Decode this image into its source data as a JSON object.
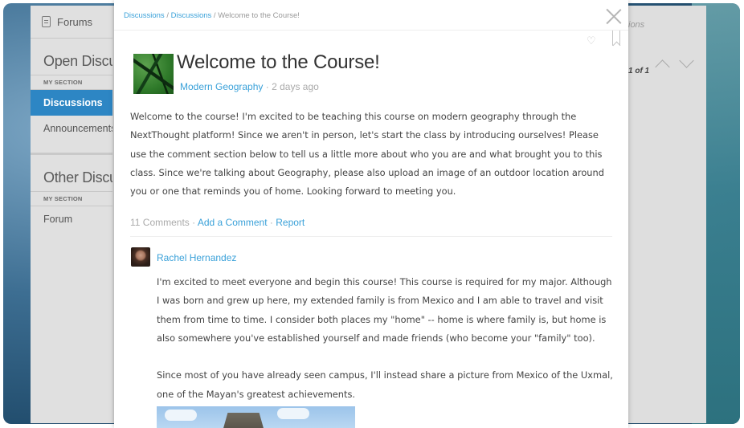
{
  "sidebar": {
    "header": "Forums",
    "open_title": "Open Discussions",
    "open_section": "MY SECTION",
    "items": [
      "Discussions",
      "Announcements"
    ],
    "other_title": "Other Discussions",
    "other_section": "MY SECTION",
    "other_items": [
      "Forum"
    ]
  },
  "right_pane": {
    "partial_label": "ions",
    "pager": "1 of 1"
  },
  "modal": {
    "breadcrumb": [
      "Discussions",
      "Discussions",
      "Welcome to the Course!"
    ],
    "title": "Welcome to the Course!",
    "author": "Modern Geography",
    "time": "2 days ago",
    "body": "Welcome to the course! I'm excited to be teaching this course on modern geography through the NextThought platform! Since we aren't in person, let's start the class by introducing ourselves! Please use the comment section below to tell us a little more about who you are and what brought you to this class. Since we're talking about Geography, please also upload an image of an outdoor location around you or one that reminds you of home. Looking forward to meeting you.",
    "comment_count": "11 Comments",
    "add_comment": "Add a Comment",
    "report": "Report",
    "comment": {
      "author": "Rachel Hernandez",
      "paragraph1": "I'm excited to meet everyone and begin this course! This course is required for my major. Although I was born and grew up here, my extended family is from Mexico and I am able to travel and visit them from time to time. I consider both places my \"home\" -- home is where family is, but home is also somewhere you've established yourself and made friends (who become your \"family\" too).",
      "paragraph2": "Since most of you have already seen campus, I'll instead share a picture from Mexico of the Uxmal, one of the Mayan's greatest achievements."
    }
  },
  "colors": {
    "accent": "#3aa1d9",
    "active_item": "#2d86c4"
  }
}
